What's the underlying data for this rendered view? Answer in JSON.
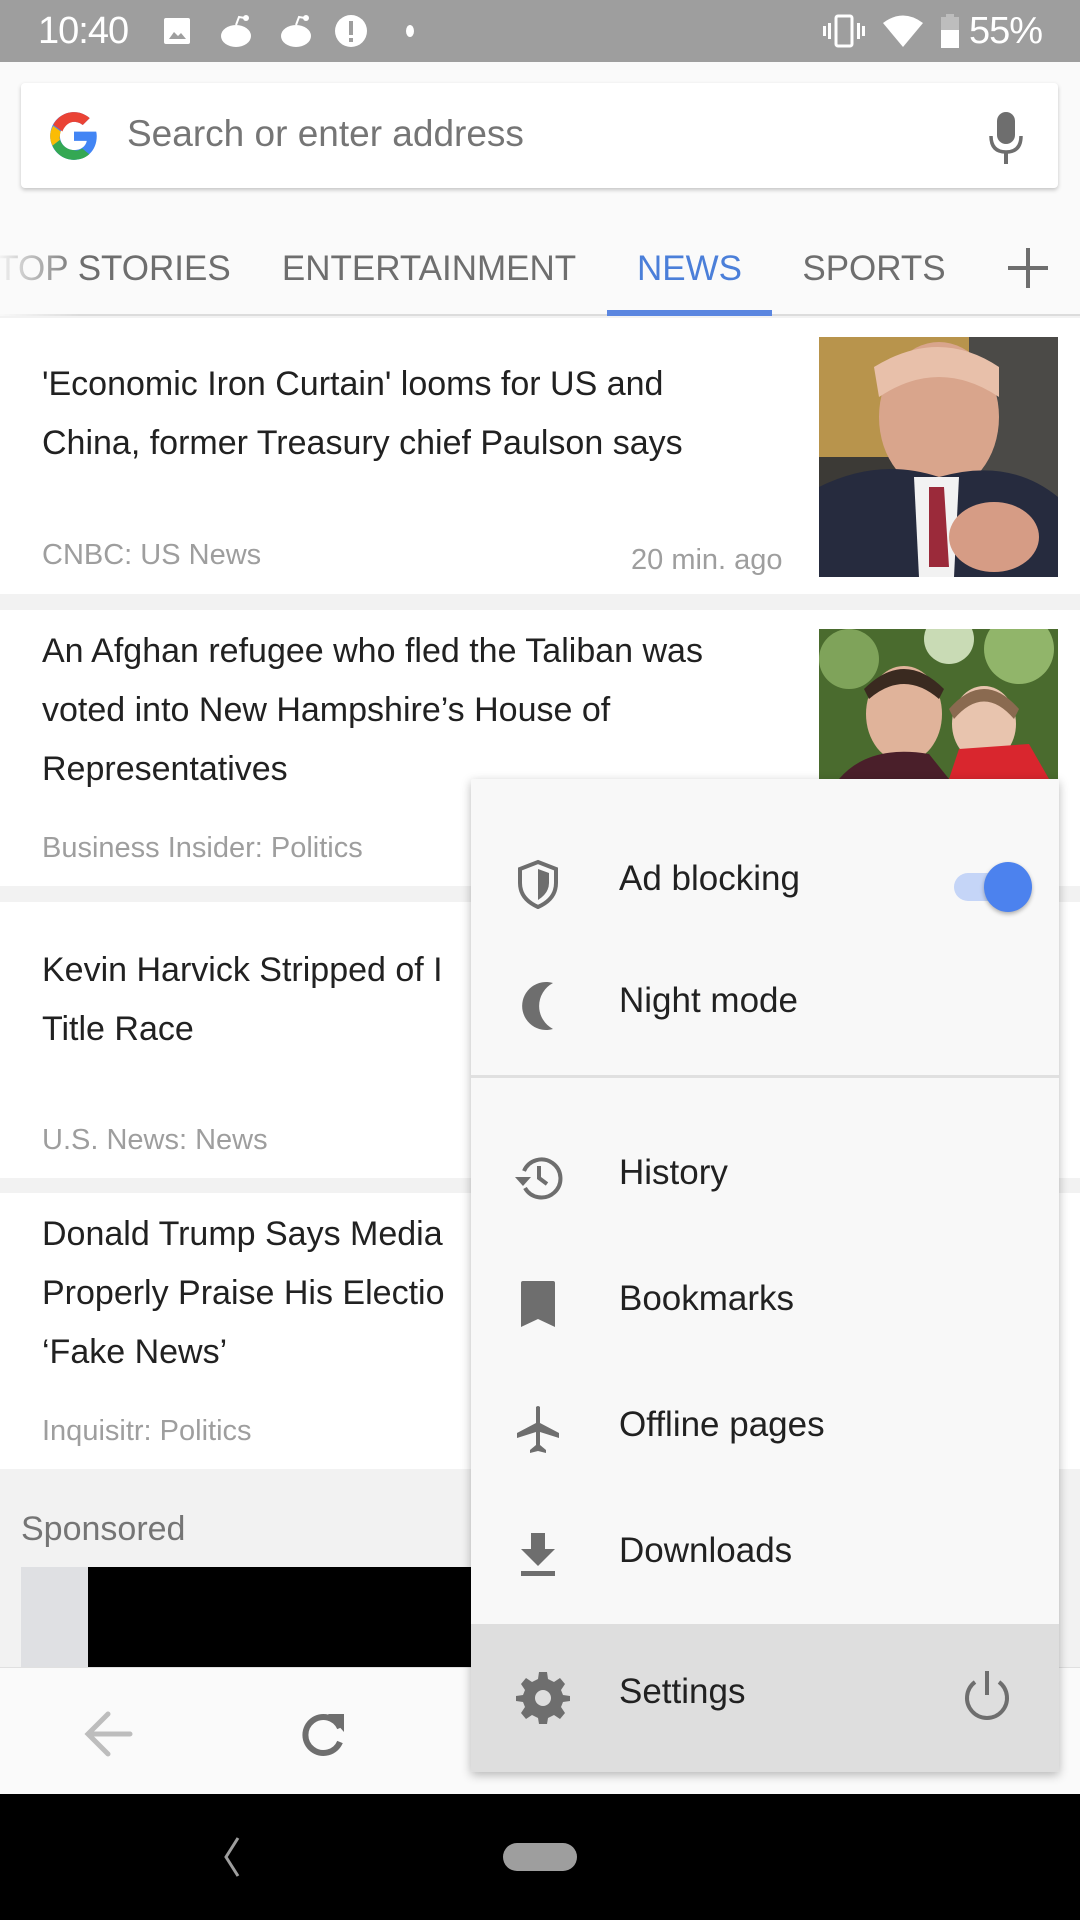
{
  "status_bar": {
    "time": "10:40",
    "battery_percent": "55%",
    "notification_icons": [
      "image-icon",
      "reddit-icon",
      "reddit-icon",
      "alert-icon",
      "dot-icon"
    ],
    "system_icons": [
      "vibrate-icon",
      "wifi-icon",
      "battery-icon"
    ]
  },
  "search": {
    "placeholder": "Search or enter address"
  },
  "tabs": [
    {
      "label": "TOP STORIES",
      "active": false
    },
    {
      "label": "ENTERTAINMENT",
      "active": false
    },
    {
      "label": "NEWS",
      "active": true
    },
    {
      "label": "SPORTS",
      "active": false
    }
  ],
  "colors": {
    "accent": "#4b7fd9",
    "toggle_on": "#4c82ee",
    "status_bar": "#9e9e9e"
  },
  "articles": [
    {
      "title_lines": [
        "'Economic Iron Curtain' looms for US and",
        "China, former Treasury chief Paulson says"
      ],
      "source": "CNBC: US News",
      "time": "20 min. ago",
      "thumbnail": "man-in-suit-photo"
    },
    {
      "title_lines": [
        "An Afghan refugee who fled the Taliban was",
        "voted into New Hampshire’s House of",
        "Representatives"
      ],
      "source": "Business Insider: Politics",
      "thumbnail": "woman-and-child-photo"
    },
    {
      "title_lines": [
        "Kevin Harvick Stripped of I",
        "Title Race"
      ],
      "source": "U.S. News: News"
    },
    {
      "title_lines": [
        "Donald Trump Says Media",
        "Properly Praise His Electio",
        "‘Fake News’"
      ],
      "source": "Inquisitr: Politics"
    }
  ],
  "sponsored_label": "Sponsored",
  "menu": {
    "ad_blocking": {
      "label": "Ad blocking",
      "enabled": true
    },
    "night_mode": {
      "label": "Night mode"
    },
    "history": {
      "label": "History"
    },
    "bookmarks": {
      "label": "Bookmarks"
    },
    "offline_pages": {
      "label": "Offline pages"
    },
    "downloads": {
      "label": "Downloads"
    },
    "settings": {
      "label": "Settings"
    }
  }
}
